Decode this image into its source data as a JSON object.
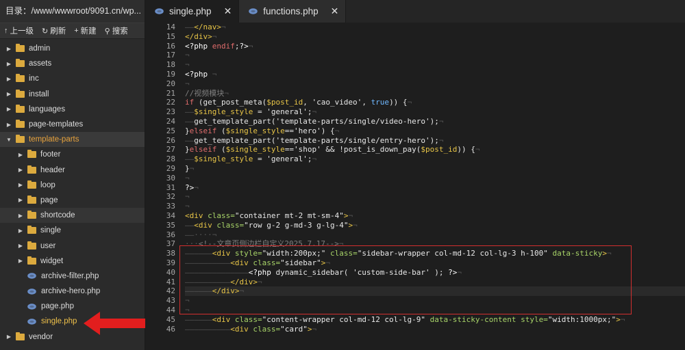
{
  "sidebar": {
    "path": "目录：/www/wwwroot/9091.cn/wp...",
    "toolbar": [
      {
        "icon": "arrow-up-icon",
        "glyph": "↑",
        "label": "上一级"
      },
      {
        "icon": "refresh-icon",
        "glyph": "↻",
        "label": "刷新"
      },
      {
        "icon": "plus-icon",
        "glyph": "+",
        "label": "新建"
      },
      {
        "icon": "search-icon",
        "glyph": "⚲",
        "label": "搜索"
      }
    ],
    "tree": [
      {
        "label": "admin",
        "type": "folder",
        "depth": 0,
        "expanded": false
      },
      {
        "label": "assets",
        "type": "folder",
        "depth": 0,
        "expanded": false
      },
      {
        "label": "inc",
        "type": "folder",
        "depth": 0,
        "expanded": false
      },
      {
        "label": "install",
        "type": "folder",
        "depth": 0,
        "expanded": false
      },
      {
        "label": "languages",
        "type": "folder",
        "depth": 0,
        "expanded": false
      },
      {
        "label": "page-templates",
        "type": "folder",
        "depth": 0,
        "expanded": false
      },
      {
        "label": "template-parts",
        "type": "folder",
        "depth": 0,
        "expanded": true,
        "style": "orange"
      },
      {
        "label": "footer",
        "type": "folder",
        "depth": 1,
        "expanded": false
      },
      {
        "label": "header",
        "type": "folder",
        "depth": 1,
        "expanded": false
      },
      {
        "label": "loop",
        "type": "folder",
        "depth": 1,
        "expanded": false
      },
      {
        "label": "page",
        "type": "folder",
        "depth": 1,
        "expanded": false
      },
      {
        "label": "shortcode",
        "type": "folder",
        "depth": 1,
        "expanded": false,
        "hl": true
      },
      {
        "label": "single",
        "type": "folder",
        "depth": 1,
        "expanded": false
      },
      {
        "label": "user",
        "type": "folder",
        "depth": 1,
        "expanded": false
      },
      {
        "label": "widget",
        "type": "folder",
        "depth": 1,
        "expanded": false
      },
      {
        "label": "archive-filter.php",
        "type": "php",
        "depth": 1
      },
      {
        "label": "archive-hero.php",
        "type": "php",
        "depth": 1
      },
      {
        "label": "page.php",
        "type": "php",
        "depth": 1
      },
      {
        "label": "single.php",
        "type": "php",
        "depth": 1,
        "style": "active"
      },
      {
        "label": "vendor",
        "type": "folder",
        "depth": 0,
        "expanded": false
      }
    ]
  },
  "tabs": [
    {
      "label": "single.php",
      "active": true,
      "close": "✕"
    },
    {
      "label": "functions.php",
      "active": false,
      "close": "✕"
    }
  ],
  "collapse_glyph": "❮",
  "editor": {
    "current_line": 42,
    "lines": [
      {
        "n": "14",
        "html": "<span class='ws'>——</span><span class='tok-tag'>&lt;/nav&gt;</span><span class='ws'>¬</span>"
      },
      {
        "n": "15",
        "html": "<span class='tok-tag'>&lt;/div&gt;</span><span class='ws'>¬</span>"
      },
      {
        "n": "16",
        "html": "<span class='tok-php'>&lt;?php</span> <span class='tok-kw'>endif</span>;<span class='tok-php'>?&gt;</span><span class='ws'>¬</span>"
      },
      {
        "n": "17",
        "html": "<span class='ws'>¬</span>"
      },
      {
        "n": "18",
        "html": "<span class='ws'>¬</span>"
      },
      {
        "n": "19",
        "html": "<span class='tok-php'>&lt;?php</span> <span class='ws'>¬</span>"
      },
      {
        "n": "20",
        "html": "<span class='ws'>¬</span>"
      },
      {
        "n": "21",
        "html": "<span class='tok-cmt'>//视频模块</span><span class='ws'>¬</span>"
      },
      {
        "n": "22",
        "html": "<span class='tok-kw'>if</span> (get_post_meta(<span class='tok-var'>$post_id</span>, <span class='tok-str'>'cao_video'</span>, <span class='tok-bool'>true</span>)) {<span class='ws'>¬</span>"
      },
      {
        "n": "23",
        "html": "<span class='ws'>——</span><span class='tok-var'>$single_style</span> = <span class='tok-str'>'general'</span>;<span class='ws'>¬</span>"
      },
      {
        "n": "24",
        "html": "<span class='ws'>——</span>get_template_part(<span class='tok-str'>'template-parts/single/video-hero'</span>);<span class='ws'>¬</span>"
      },
      {
        "n": "25",
        "html": "}<span class='tok-kw'>elseif</span> (<span class='tok-var'>$single_style</span>==<span class='tok-str'>'hero'</span>) {<span class='ws'>¬</span>"
      },
      {
        "n": "26",
        "html": "<span class='ws'>——</span>get_template_part(<span class='tok-str'>'template-parts/single/entry-hero'</span>);<span class='ws'>¬</span>"
      },
      {
        "n": "27",
        "html": "}<span class='tok-kw'>elseif</span> (<span class='tok-var'>$single_style</span>==<span class='tok-str'>'shop'</span> &amp;&amp; !post_is_down_pay(<span class='tok-var'>$post_id</span>)) {<span class='ws'>¬</span>"
      },
      {
        "n": "28",
        "html": "<span class='ws'>——</span><span class='tok-var'>$single_style</span> = <span class='tok-str'>'general'</span>;<span class='ws'>¬</span>"
      },
      {
        "n": "29",
        "html": "}<span class='ws'>¬</span>"
      },
      {
        "n": "30",
        "html": "<span class='ws'>¬</span>"
      },
      {
        "n": "31",
        "html": "<span class='tok-php'>?&gt;</span><span class='ws'>¬</span>"
      },
      {
        "n": "32",
        "html": "<span class='ws'>¬</span>"
      },
      {
        "n": "33",
        "html": "<span class='ws'>¬</span>"
      },
      {
        "n": "34",
        "html": "<span class='tok-tag'>&lt;div</span> <span class='tok-attr'>class=</span><span class='tok-str'>\"container mt-2 mt-sm-4\"</span><span class='tok-tag'>&gt;</span><span class='ws'>¬</span>"
      },
      {
        "n": "35",
        "html": "<span class='ws'>——</span><span class='tok-tag'>&lt;div</span> <span class='tok-attr'>class=</span><span class='tok-str'>\"row g-2 g-md-3 g-lg-4\"</span><span class='tok-tag'>&gt;</span><span class='ws'>¬</span>"
      },
      {
        "n": "36",
        "html": "<span class='ws'>——····¬</span>"
      },
      {
        "n": "37",
        "html": "<span class='ws'>···</span><span class='tok-cmt'>&lt;!--文章页侧边栏自定义2025.7.17--&gt;</span><span class='ws'>¬</span>"
      },
      {
        "n": "38",
        "html": "<span class='ws'>——————</span><span class='tok-tag'>&lt;div</span> <span class='tok-attr'>style=</span><span class='tok-str'>\"width:200px;\"</span> <span class='tok-attr'>class=</span><span class='tok-str'>\"sidebar-wrapper col-md-12 col-lg-3 h-100\"</span> <span class='tok-attr'>data-sticky</span><span class='tok-tag'>&gt;</span><span class='ws'>¬</span>"
      },
      {
        "n": "39",
        "html": "<span class='ws'>——————————</span><span class='tok-tag'>&lt;div</span> <span class='tok-attr'>class=</span><span class='tok-str'>\"sidebar\"</span><span class='tok-tag'>&gt;</span><span class='ws'>¬</span>"
      },
      {
        "n": "40",
        "html": "<span class='ws'>——————————————</span><span class='tok-php'>&lt;?php</span> dynamic_sidebar( <span class='tok-str'>'custom-side-bar'</span> ); <span class='tok-php'>?&gt;</span><span class='ws'>¬</span>"
      },
      {
        "n": "41",
        "html": "<span class='ws'>——————————</span><span class='tok-tag'>&lt;/div&gt;</span><span class='ws'>¬</span>"
      },
      {
        "n": "42",
        "html": "<span class='ws'>——————</span><span class='tok-tag'>&lt;/div&gt;</span><span class='ws'>¬</span>"
      },
      {
        "n": "43",
        "html": "<span class='ws'>¬</span>"
      },
      {
        "n": "44",
        "html": "<span class='ws'>¬</span>"
      },
      {
        "n": "45",
        "html": "<span class='ws'>——————</span><span class='tok-tag'>&lt;div</span> <span class='tok-attr'>class=</span><span class='tok-str'>\"content-wrapper col-md-12 col-lg-9\"</span> <span class='tok-attr'>data-sticky-content</span> <span class='tok-attr'>style=</span><span class='tok-str'>\"width:1000px;\"</span><span class='tok-tag'>&gt;</span><span class='ws'>¬</span>"
      },
      {
        "n": "46",
        "html": "<span class='ws'>——————————</span><span class='tok-tag'>&lt;div</span> <span class='tok-attr'>class=</span><span class='tok-str'>\"card\"</span><span class='tok-tag'>&gt;</span><span class='ws'>¬</span>"
      }
    ]
  }
}
